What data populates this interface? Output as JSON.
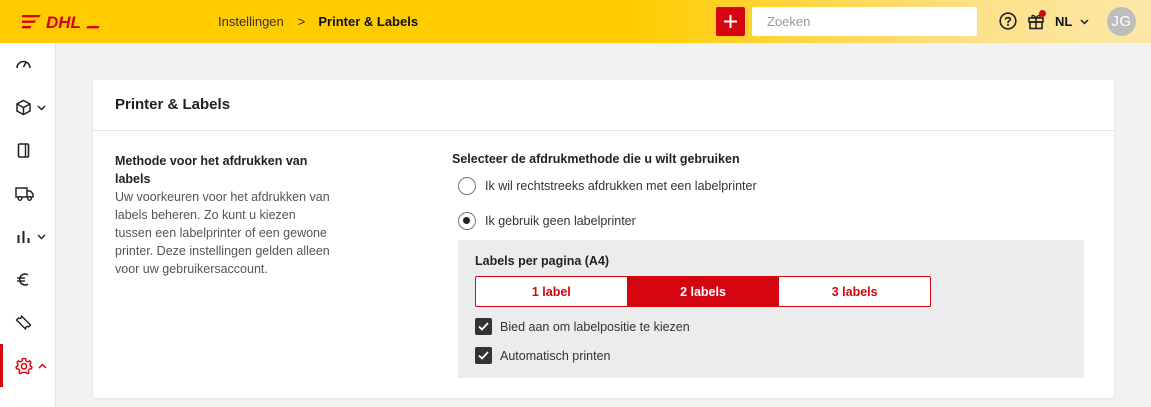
{
  "header": {
    "logo_text": "DHL",
    "breadcrumb": {
      "parent": "Instellingen",
      "separator": ">",
      "current": "Printer & Labels"
    },
    "add_icon": "plus-icon",
    "search": {
      "placeholder": "Zoeken",
      "value": ""
    },
    "help_icon": "question-icon",
    "gift_icon": "gift-icon",
    "language": "NL",
    "avatar_initials": "JG"
  },
  "sidebar": {
    "items": [
      {
        "icon": "dashboard-icon",
        "expandable": false
      },
      {
        "icon": "package-icon",
        "expandable": true
      },
      {
        "icon": "document-icon",
        "expandable": false
      },
      {
        "icon": "truck-icon",
        "expandable": false
      },
      {
        "icon": "bar-chart-icon",
        "expandable": true
      },
      {
        "icon": "euro-icon",
        "expandable": false
      },
      {
        "icon": "ticket-icon",
        "expandable": false
      },
      {
        "icon": "gear-icon",
        "expandable": true,
        "active": true
      }
    ]
  },
  "card": {
    "title": "Printer & Labels",
    "left": {
      "title": "Methode voor het afdrukken van labels",
      "description": "Uw voorkeuren voor het afdrukken van labels beheren. Zo kunt u kiezen tussen een labelprinter of een gewone printer. Deze instellingen gelden alleen voor uw gebruikersaccount."
    },
    "right": {
      "title": "Selecteer de afdrukmethode die u wilt gebruiken",
      "radio_options": [
        {
          "label": "Ik wil rechtstreeks afdrukken met een labelprinter",
          "checked": false
        },
        {
          "label": "Ik gebruik geen labelprinter",
          "checked": true
        }
      ],
      "labels_per_page": {
        "title": "Labels per pagina (A4)",
        "options": [
          "1 label",
          "2 labels",
          "3 labels"
        ],
        "selected": "2 labels"
      },
      "checkboxes": [
        {
          "label": "Bied aan om labelpositie te kiezen",
          "checked": true
        },
        {
          "label": "Automatisch printen",
          "checked": true
        }
      ]
    }
  },
  "colors": {
    "brand_yellow": "#ffcc00",
    "brand_red": "#d40511"
  }
}
